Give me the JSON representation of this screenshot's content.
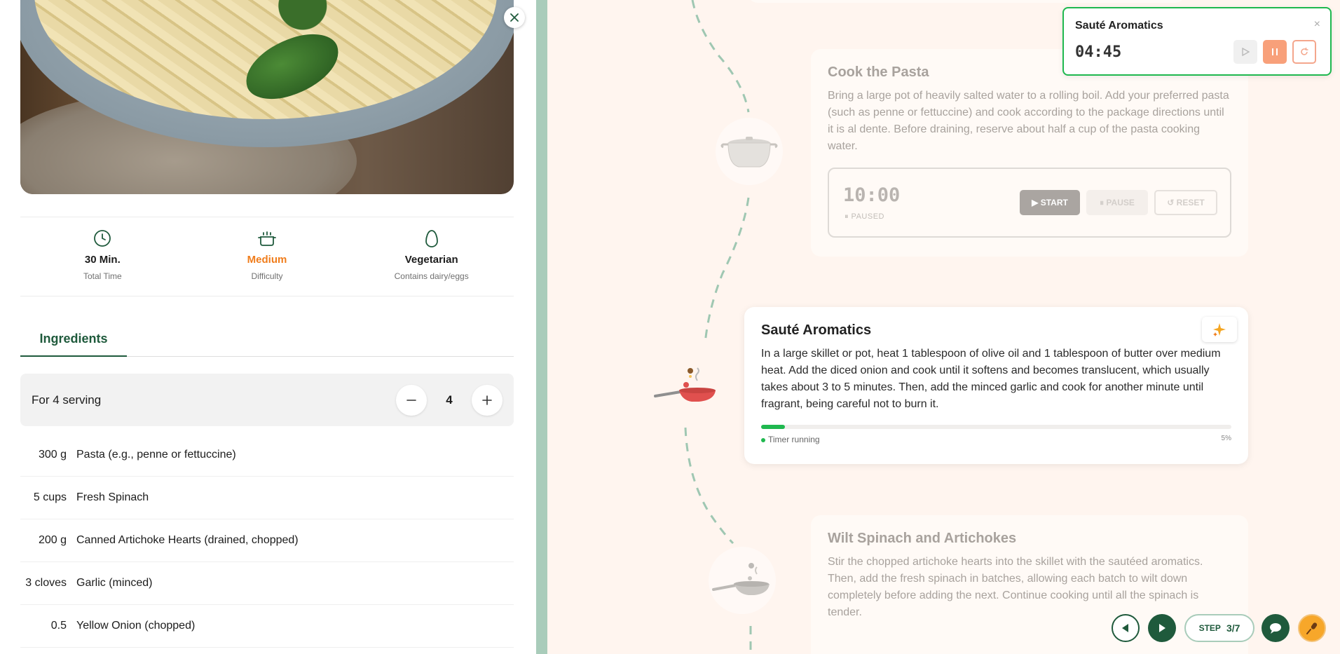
{
  "stats": [
    {
      "icon": "clock-icon",
      "value": "30 Min.",
      "label": "Total Time"
    },
    {
      "icon": "pot-icon",
      "value": "Medium",
      "label": "Difficulty"
    },
    {
      "icon": "egg-icon",
      "value": "Vegetarian",
      "label": "Contains dairy/eggs"
    }
  ],
  "tabs": {
    "ingredients": "Ingredients"
  },
  "serving": {
    "label": "For 4 serving",
    "count": "4",
    "minus": "−",
    "plus": "+"
  },
  "ingredients": [
    {
      "qty": "300 g",
      "name": "Pasta (e.g., penne or fettuccine)"
    },
    {
      "qty": "5 cups",
      "name": "Fresh Spinach"
    },
    {
      "qty": "200 g",
      "name": "Canned Artichoke Hearts (drained, chopped)"
    },
    {
      "qty": "3 cloves",
      "name": "Garlic (minced)"
    },
    {
      "qty": "0.5",
      "name": "Yellow Onion (chopped)"
    }
  ],
  "steps": {
    "cook_pasta": {
      "title": "Cook the Pasta",
      "text": "Bring a large pot of heavily salted water to a rolling boil. Add your preferred pasta (such as penne or fettuccine) and cook according to the package directions until it is al dente. Before draining, reserve about half a cup of the pasta cooking water.",
      "timer": "10:00",
      "state": "⏸ PAUSED",
      "start": "▶ START",
      "pause": "⏸ PAUSE",
      "reset": "↺ RESET"
    },
    "saute": {
      "title": "Sauté Aromatics",
      "text": "In a large skillet or pot, heat 1 tablespoon of olive oil and 1 tablespoon of butter over medium heat. Add the diced onion and cook until it softens and becomes translucent, which usually takes about 3 to 5 minutes. Then, add the minced garlic and cook for another minute until fragrant, being careful not to burn it.",
      "status": "Timer running",
      "progress_label": "5%",
      "progress": 0.05
    },
    "wilt": {
      "title": "Wilt Spinach and Artichokes",
      "text": "Stir the chopped artichoke hearts into the skillet with the sautéed aromatics. Then, add the fresh spinach in batches, allowing each batch to wilt down completely before adding the next. Continue cooking until all the spinach is tender."
    }
  },
  "popup": {
    "title": "Sauté Aromatics",
    "time": "04:45",
    "close": "×"
  },
  "nav": {
    "step_label": "STEP",
    "step_value": "3/7"
  },
  "colors": {
    "brand": "#1f5a3c",
    "accent": "#f07d1c",
    "running": "#1fb84f"
  }
}
